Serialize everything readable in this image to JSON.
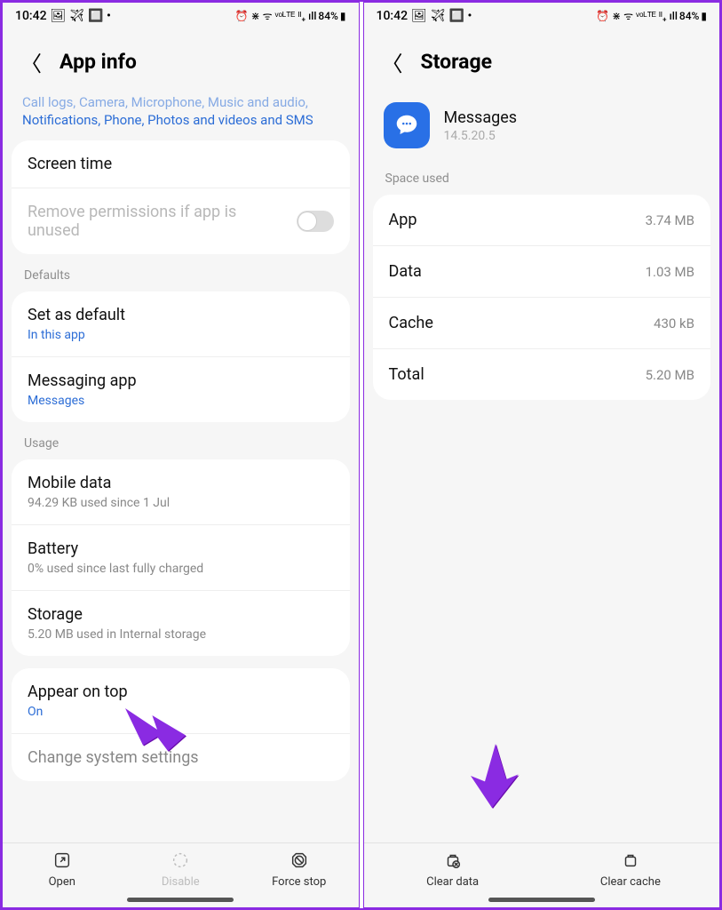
{
  "status": {
    "time": "10:42",
    "left_icons": "🖼 ✈ 🔲 •",
    "right_icons": "⏰ ⋇ ᯤ ᵛᵒᴸᵀᴱ ᴵᴵ₊ ıll",
    "battery": "84%"
  },
  "left": {
    "title": "App info",
    "permissions_cut": "Call logs, Camera, Microphone, Music and audio,",
    "permissions_line2": "Notifications, Phone, Photos and videos and SMS",
    "screen_time": "Screen time",
    "remove_perm": "Remove permissions if app is unused",
    "section_defaults": "Defaults",
    "set_default": "Set as default",
    "set_default_sub": "In this app",
    "messaging_app": "Messaging app",
    "messaging_app_sub": "Messages",
    "section_usage": "Usage",
    "mobile_data": "Mobile data",
    "mobile_data_sub": "94.29 KB used since 1 Jul",
    "battery": "Battery",
    "battery_sub": "0% used since last fully charged",
    "storage": "Storage",
    "storage_sub": "5.20 MB used in Internal storage",
    "appear": "Appear on top",
    "appear_sub": "On",
    "change_sys": "Change system settings",
    "btn_open": "Open",
    "btn_disable": "Disable",
    "btn_force": "Force stop"
  },
  "right": {
    "title": "Storage",
    "app_name": "Messages",
    "app_version": "14.5.20.5",
    "section_space": "Space used",
    "rows": {
      "app": {
        "k": "App",
        "v": "3.74 MB"
      },
      "data": {
        "k": "Data",
        "v": "1.03 MB"
      },
      "cache": {
        "k": "Cache",
        "v": "430 kB"
      },
      "total": {
        "k": "Total",
        "v": "5.20 MB"
      }
    },
    "btn_clear_data": "Clear data",
    "btn_clear_cache": "Clear cache"
  }
}
